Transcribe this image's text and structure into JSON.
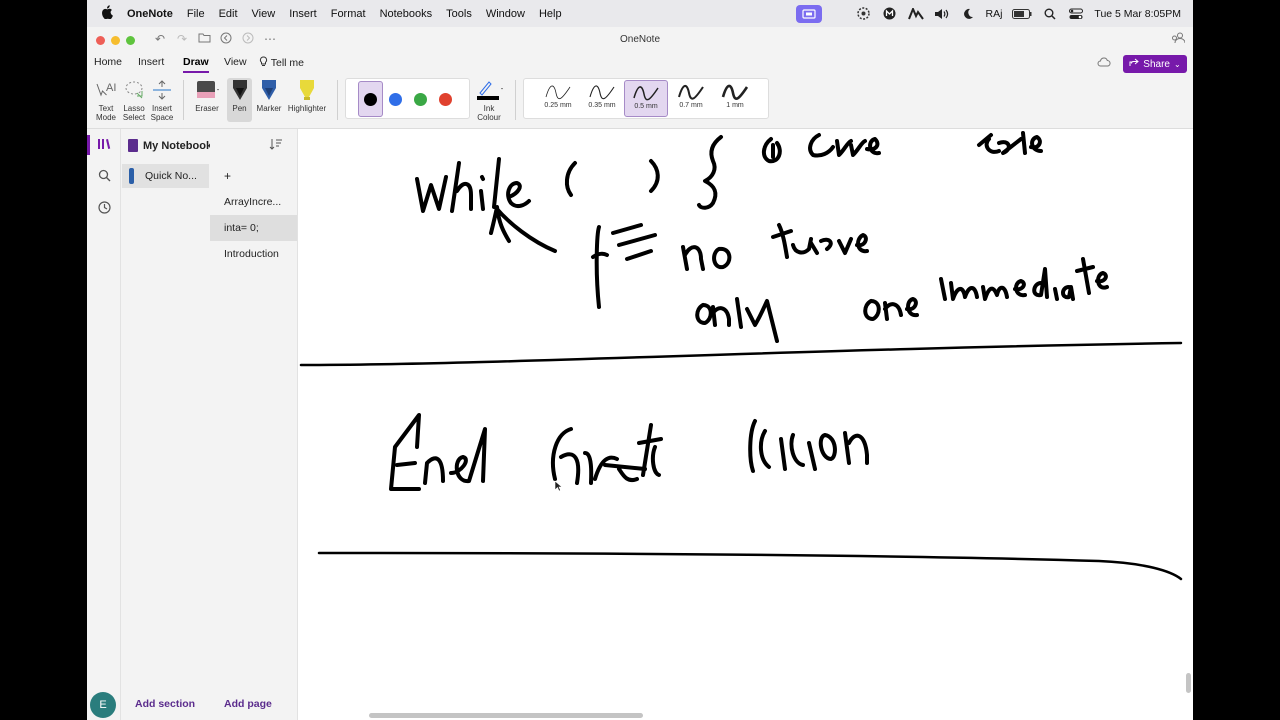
{
  "menubar": {
    "app": "OneNote",
    "menus": [
      "File",
      "Edit",
      "View",
      "Insert",
      "Format",
      "Notebooks",
      "Tools",
      "Window",
      "Help"
    ],
    "user": "RAj",
    "datetime": "Tue 5 Mar  8:05PM"
  },
  "window": {
    "title": "OneNote"
  },
  "ribbon": {
    "tabs": [
      "Home",
      "Insert",
      "Draw",
      "View"
    ],
    "active_tab": "Draw",
    "tell_me": "Tell me",
    "share": "Share",
    "tools": {
      "text_mode": [
        "Text",
        "Mode"
      ],
      "lasso_select": [
        "Lasso",
        "Select"
      ],
      "insert_space": [
        "Insert",
        "Space"
      ],
      "eraser": "Eraser",
      "pen": "Pen",
      "marker": "Marker",
      "highlighter": "Highlighter",
      "ink_colour": [
        "Ink",
        "Colour"
      ]
    },
    "colors": [
      "#000000",
      "#2f6ee8",
      "#3aa845",
      "#e0412e"
    ],
    "selected_color": "#000000",
    "thickness": [
      "0.25 mm",
      "0.35 mm",
      "0.5 mm",
      "0.7 mm",
      "1 mm"
    ],
    "selected_thickness": "0.5 mm"
  },
  "navigation": {
    "notebook": "My Notebook",
    "sections": [
      "Quick No..."
    ],
    "add_section": "Add section",
    "pages": [
      "+",
      "ArrayIncre...",
      "inta= 0;",
      "Introduction"
    ],
    "selected_page": "inta= 0;",
    "add_page": "Add page",
    "avatar": "E"
  },
  "colors": {
    "accent": "#7719aa",
    "section_tab": "#2b5fa8"
  }
}
